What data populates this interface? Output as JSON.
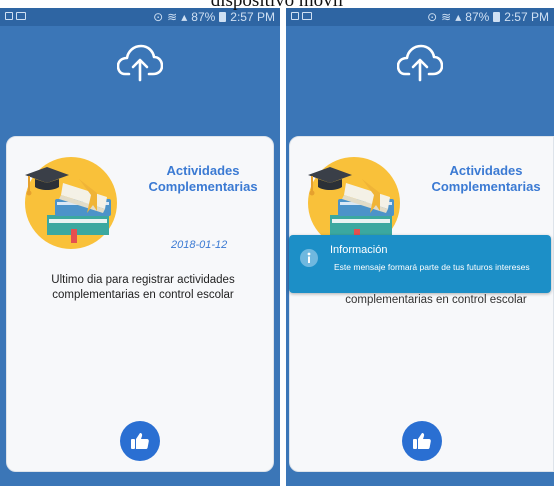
{
  "caption": "dispositivo móvil",
  "status_bar": {
    "battery": "87%",
    "time": "2:57 PM"
  },
  "card": {
    "title": "Actividades Complementarias",
    "date": "2018-01-12",
    "message": "Ultimo dia para registrar actividades complementarias en control escolar",
    "message_visible_fragment": "complementarias en control escolar"
  },
  "toast": {
    "title": "Información",
    "body": "Este mensaje formará parte de tus futuros intereses"
  },
  "colors": {
    "app_background": "#3b76b7",
    "status_bar": "#2e65a3",
    "accent_blue": "#3b7ad3",
    "toast_background": "#1c8fc7",
    "card_background": "#f7f8fa"
  },
  "icons": [
    "cloud-upload-icon",
    "graduation-books-illustration",
    "thumbs-up-icon",
    "info-icon"
  ]
}
